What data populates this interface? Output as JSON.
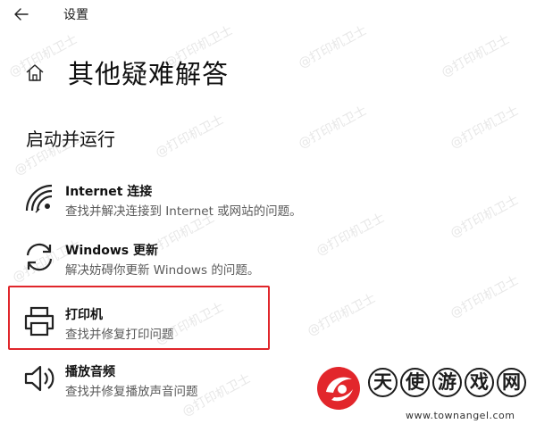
{
  "window": {
    "title": "设置"
  },
  "page": {
    "title": "其他疑难解答"
  },
  "section": {
    "title": "启动并运行"
  },
  "items": [
    {
      "label": "Internet 连接",
      "description": "查找并解决连接到 Internet 或网站的问题。",
      "icon": "wifi-icon"
    },
    {
      "label": "Windows 更新",
      "description": "解决妨碍你更新 Windows 的问题。",
      "icon": "sync-icon"
    },
    {
      "label": "打印机",
      "description": "查找并修复打印问题",
      "icon": "printer-icon"
    },
    {
      "label": "播放音频",
      "description": "查找并修复播放声音问题",
      "icon": "speaker-icon"
    }
  ],
  "watermark": {
    "text": "@打印机卫士"
  },
  "brand": {
    "chars": [
      "天",
      "使",
      "游",
      "戏",
      "网"
    ],
    "url": "www.townangel.com",
    "colors": {
      "logo_red": "#e2262b",
      "ink": "#1c1c1c"
    }
  },
  "colors": {
    "highlight_border": "#e0262b",
    "description_text": "#5a5a5a"
  }
}
